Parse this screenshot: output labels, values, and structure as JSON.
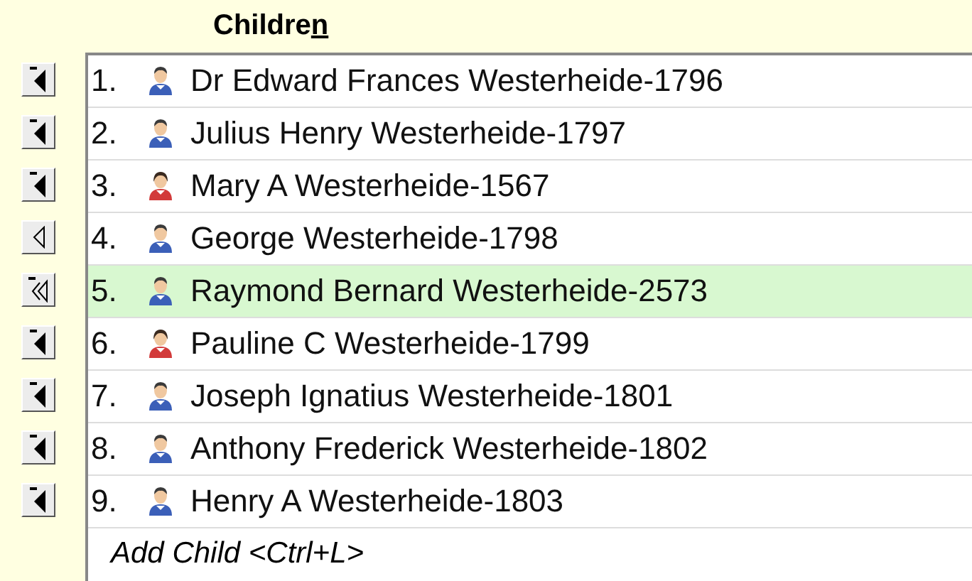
{
  "title": {
    "text": "Childre",
    "access_key": "n"
  },
  "children": [
    {
      "number": "1.",
      "name": "Dr Edward Frances Westerheide-1796",
      "person": {
        "kind": "male"
      },
      "button": {
        "kind": "filled"
      },
      "selected": false
    },
    {
      "number": "2.",
      "name": "Julius Henry Westerheide-1797",
      "person": {
        "kind": "male"
      },
      "button": {
        "kind": "filled"
      },
      "selected": false
    },
    {
      "number": "3.",
      "name": "Mary A Westerheide-1567",
      "person": {
        "kind": "female"
      },
      "button": {
        "kind": "filled"
      },
      "selected": false
    },
    {
      "number": "4.",
      "name": "George Westerheide-1798",
      "person": {
        "kind": "male"
      },
      "button": {
        "kind": "hollow"
      },
      "selected": false
    },
    {
      "number": "5.",
      "name": "Raymond Bernard Westerheide-2573",
      "person": {
        "kind": "male"
      },
      "button": {
        "kind": "double"
      },
      "selected": true
    },
    {
      "number": "6.",
      "name": "Pauline C Westerheide-1799",
      "person": {
        "kind": "female"
      },
      "button": {
        "kind": "filled"
      },
      "selected": false
    },
    {
      "number": "7.",
      "name": "Joseph Ignatius Westerheide-1801",
      "person": {
        "kind": "male"
      },
      "button": {
        "kind": "filled"
      },
      "selected": false
    },
    {
      "number": "8.",
      "name": "Anthony Frederick Westerheide-1802",
      "person": {
        "kind": "male"
      },
      "button": {
        "kind": "filled"
      },
      "selected": false
    },
    {
      "number": "9.",
      "name": "Henry A Westerheide-1803",
      "person": {
        "kind": "male"
      },
      "button": {
        "kind": "filled"
      },
      "selected": false
    }
  ],
  "add_child": "Add Child <Ctrl+L>"
}
